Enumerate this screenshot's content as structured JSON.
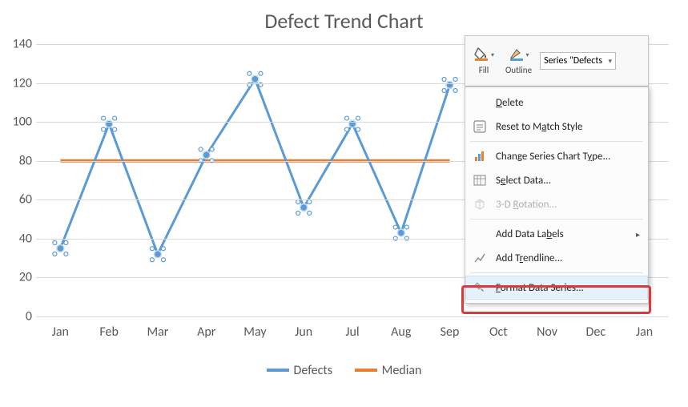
{
  "chart": {
    "title": "Defect Trend Chart"
  },
  "chart_data": {
    "type": "line",
    "categories": [
      "Jan",
      "Feb",
      "Mar",
      "Apr",
      "May",
      "Jun",
      "Jul",
      "Aug",
      "Sep",
      "Oct",
      "Nov",
      "Dec",
      "Jan"
    ],
    "series": [
      {
        "name": "Defects",
        "values": [
          35,
          99,
          32,
          83,
          122,
          56,
          99,
          43,
          119,
          null,
          null,
          null,
          null
        ],
        "color": "#5b9bd5"
      },
      {
        "name": "Median",
        "values": [
          80,
          80,
          80,
          80,
          80,
          80,
          80,
          80,
          80,
          null,
          null,
          null,
          null
        ],
        "color": "#ed7d31"
      }
    ],
    "ylim": [
      0,
      140
    ],
    "yticks": [
      0,
      20,
      40,
      60,
      80,
      100,
      120,
      140
    ],
    "xlabel": "",
    "ylabel": "",
    "title": "Defect Trend Chart"
  },
  "legend": {
    "defects": "Defects",
    "median": "Median"
  },
  "toolbar": {
    "fill_label": "Fill",
    "outline_label": "Outline",
    "series_selector": "Series \"Defects"
  },
  "menu": {
    "delete": "elete",
    "delete_prefix": "D",
    "reset": "Reset to M",
    "reset_mid": "a",
    "reset_suffix": "tch Style",
    "change_type": "Change Series Chart T",
    "change_type_mid": "y",
    "change_type_suffix": "pe...",
    "select_data_prefix": "S",
    "select_data_mid": "e",
    "select_data_suffix": "lect Data...",
    "rotation_prefix": "3-D ",
    "rotation_mid": "R",
    "rotation_suffix": "otation...",
    "labels_prefix": "Add Data La",
    "labels_mid": "b",
    "labels_suffix": "els",
    "trendline_prefix": "Add T",
    "trendline_mid": "r",
    "trendline_suffix": "endline...",
    "format_prefix": "F",
    "format_mid": "o",
    "format_suffix": "rmat Data Series..."
  }
}
